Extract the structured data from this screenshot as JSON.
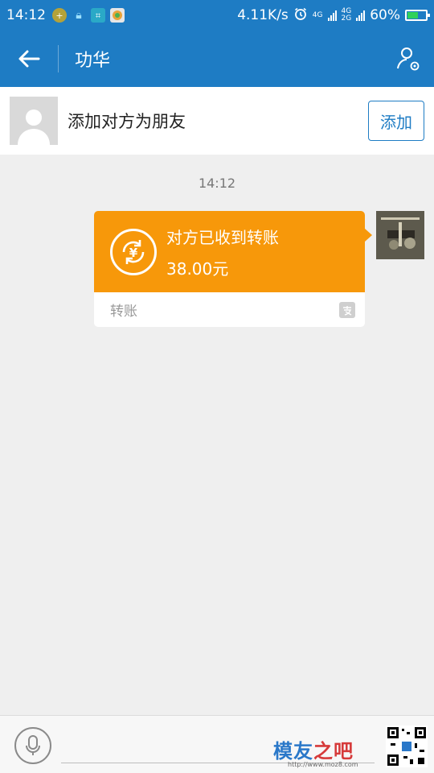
{
  "status_bar": {
    "time": "14:12",
    "speed": "4.11K/s",
    "network1": "4G",
    "network2": "4G",
    "network2_sub": "2G",
    "battery": "60%",
    "battery_level": 0.6
  },
  "header": {
    "title": "功华"
  },
  "add_friend": {
    "text": "添加对方为朋友",
    "button": "添加"
  },
  "chat": {
    "time": "14:12",
    "transfer": {
      "title": "对方已收到转账",
      "amount": "38.00元",
      "type": "转账"
    }
  },
  "watermark": {
    "brand_part1": "模友",
    "brand_part2": "之吧",
    "url": "http://www.moz8.com"
  },
  "colors": {
    "header_blue": "#1e7cc4",
    "transfer_orange": "#f7980a",
    "chat_bg": "#efefef"
  }
}
